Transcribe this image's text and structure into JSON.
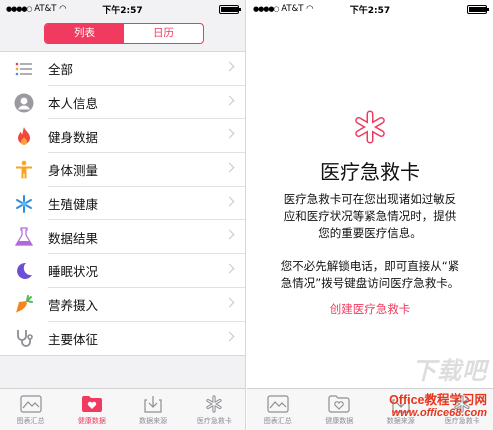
{
  "left": {
    "status": {
      "carrier": "AT&T",
      "time": "下午2:57"
    },
    "segment": {
      "list": "列表",
      "calendar": "日历"
    },
    "items": [
      {
        "label": "全部",
        "icon": "list-icon"
      },
      {
        "label": "本人信息",
        "icon": "person-icon"
      },
      {
        "label": "健身数据",
        "icon": "flame-icon"
      },
      {
        "label": "身体测量",
        "icon": "body-icon"
      },
      {
        "label": "生殖健康",
        "icon": "snowflake-icon"
      },
      {
        "label": "数据结果",
        "icon": "flask-icon"
      },
      {
        "label": "睡眠状况",
        "icon": "moon-icon"
      },
      {
        "label": "营养摄入",
        "icon": "carrot-icon"
      },
      {
        "label": "主要体征",
        "icon": "stethoscope-icon"
      }
    ],
    "tabs": [
      {
        "label": "图表汇总"
      },
      {
        "label": "健康数据"
      },
      {
        "label": "数据来源"
      },
      {
        "label": "医疗急救卡"
      }
    ]
  },
  "right": {
    "status": {
      "carrier": "AT&T",
      "time": "下午2:57"
    },
    "title": "医疗急救卡",
    "para1": [
      "医疗急救卡可在您出现诸如过敏反",
      "应和医疗状况等紧急情况时，提供",
      "您的重要医疗信息。"
    ],
    "para2": [
      "您不必先解锁电话，即可直接从“紧",
      "急情况”拨号键盘访问医疗急救卡。"
    ],
    "create": "创建医疗急救卡",
    "tabs": [
      {
        "label": "图表汇总"
      },
      {
        "label": "健康数据"
      },
      {
        "label": "数据来源"
      },
      {
        "label": "医疗急救卡"
      }
    ],
    "watermark": "下载吧",
    "site_line1": "Office教程学习网",
    "site_line2": "www.office68.com"
  },
  "colors": {
    "accent": "#f03a5f",
    "chevron": "#c7c7cc"
  }
}
